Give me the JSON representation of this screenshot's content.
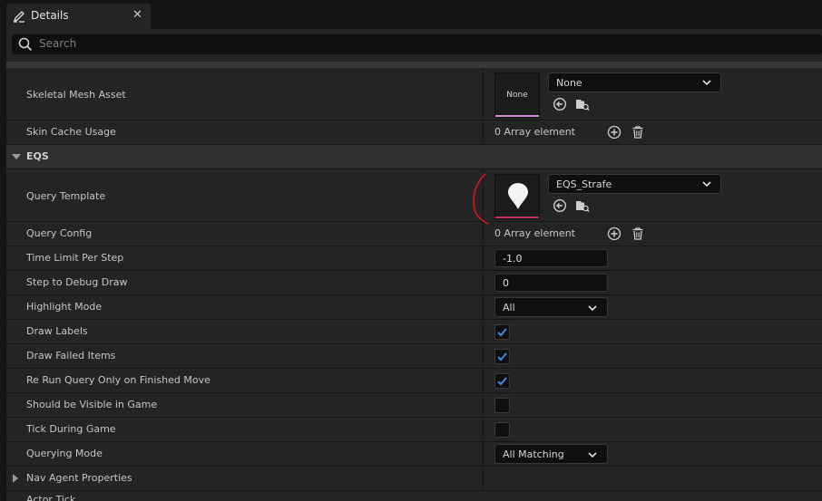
{
  "tab": {
    "title": "Details",
    "close": "✕",
    "icon": "pencil-icon"
  },
  "search": {
    "placeholder": "Search",
    "icon": "search-icon"
  },
  "rows": {
    "skeletal_mesh": {
      "label": "Skeletal Mesh Asset",
      "thumb_text": "None",
      "value": "None"
    },
    "skin_cache": {
      "label": "Skin Cache Usage",
      "value": "0 Array element"
    },
    "eqs_category": {
      "label": "EQS"
    },
    "query_template": {
      "label": "Query Template",
      "value": "EQS_Strafe"
    },
    "query_config": {
      "label": "Query Config",
      "value": "0 Array element"
    },
    "time_limit": {
      "label": "Time Limit Per Step",
      "value": "-1.0"
    },
    "step_debug": {
      "label": "Step to Debug Draw",
      "value": "0"
    },
    "highlight_mode": {
      "label": "Highlight Mode",
      "value": "All"
    },
    "draw_labels": {
      "label": "Draw Labels",
      "checked": true
    },
    "draw_failed": {
      "label": "Draw Failed Items",
      "checked": true
    },
    "rerun_query": {
      "label": "Re Run Query Only on Finished Move",
      "checked": true
    },
    "visible_in_game": {
      "label": "Should be Visible in Game",
      "checked": false
    },
    "tick_during_game": {
      "label": "Tick During Game",
      "checked": false
    },
    "querying_mode": {
      "label": "Querying Mode",
      "value": "All Matching"
    },
    "nav_agent": {
      "label": "Nav Agent Properties"
    },
    "partial_next": {
      "label": "Actor Tick"
    }
  },
  "colors": {
    "mesh_underline": "#d28ad8",
    "eqs_underline": "#c8305a",
    "checkmark": "#3a8be0",
    "annotation": "#d01818"
  }
}
